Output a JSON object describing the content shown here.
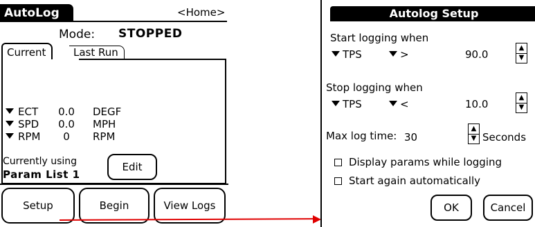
{
  "left_screen": {
    "app_title": "AutoLog",
    "home_menu": "<Home>",
    "mode_label": "Mode:",
    "mode_value": "STOPPED",
    "tabs": [
      {
        "label": "Current",
        "active": true
      },
      {
        "label": "Last Run",
        "active": false
      }
    ],
    "params": [
      {
        "name": "ECT",
        "value": "0.0",
        "unit": "DEGF"
      },
      {
        "name": "SPD",
        "value": "0.0",
        "unit": "MPH"
      },
      {
        "name": "RPM",
        "value": "0",
        "unit": "RPM"
      }
    ],
    "using_label": "Currently using",
    "using_value": "Param List 1",
    "edit_label": "Edit",
    "buttons": {
      "setup": "Setup",
      "begin": "Begin",
      "view_logs": "View Logs"
    }
  },
  "right_screen": {
    "title": "Autolog Setup",
    "start_label": "Start logging when",
    "start_param": "TPS",
    "start_op": ">",
    "start_value": "90.0",
    "stop_label": "Stop logging when",
    "stop_param": "TPS",
    "stop_op": "<",
    "stop_value": "10.0",
    "max_label": "Max log time:",
    "max_value": "30",
    "max_unit": "Seconds",
    "checkbox_display": {
      "label": "Display params while logging",
      "checked": false
    },
    "checkbox_restart": {
      "label": "Start again automatically",
      "checked": false
    },
    "ok_label": "OK",
    "cancel_label": "Cancel"
  },
  "colors": {
    "annotation_arrow": "#e00000"
  }
}
